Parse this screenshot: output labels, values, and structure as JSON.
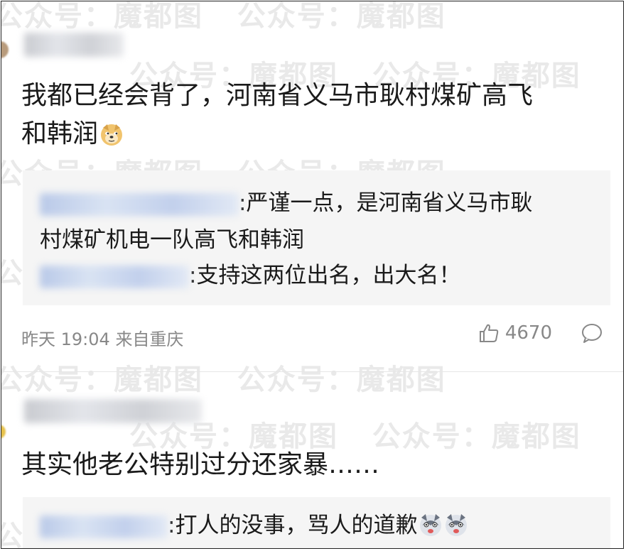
{
  "watermark_text": "公众号：魔都图",
  "comments": [
    {
      "text_line1": "我都已经会背了，河南省义马市耿村煤矿高飞",
      "text_line2": "和韩润",
      "emoji": "doge-icon",
      "replies": [
        {
          "text": ":严谨一点，是河南省义马市耿",
          "text_cont": "村煤矿机电一队高飞和韩润"
        },
        {
          "text": ":支持这两位出名，出大名！"
        }
      ],
      "time": "昨天 19:04",
      "source": "来自重庆",
      "likes": "4670"
    },
    {
      "text": "其实他老公特别过分还家暴……",
      "replies": [
        {
          "text": ":打人的没事，骂人的道歉"
        }
      ]
    }
  ]
}
